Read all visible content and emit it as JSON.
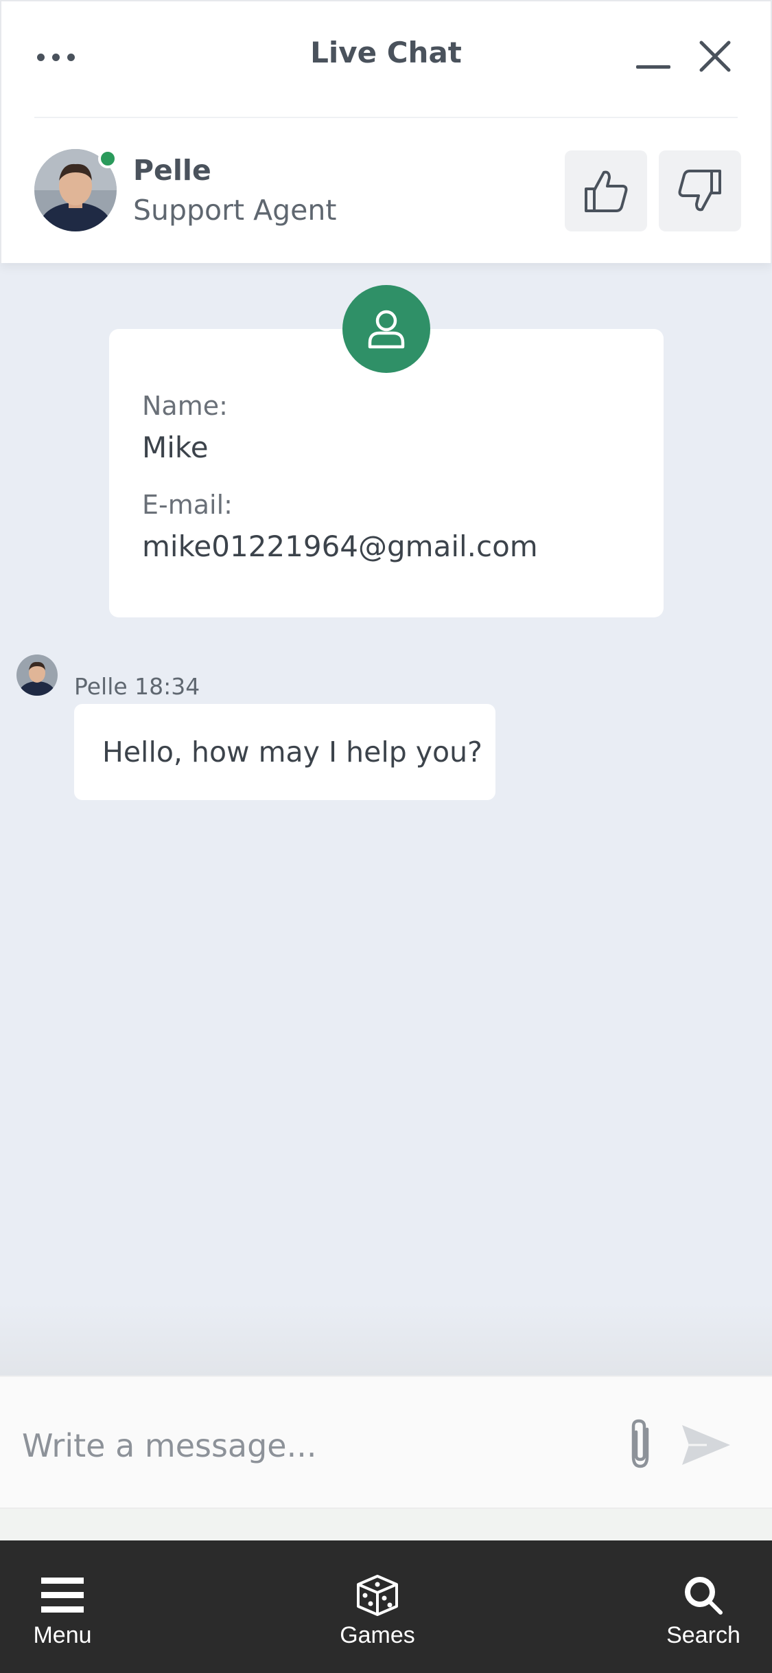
{
  "header": {
    "title": "Live Chat",
    "more_icon": "more-dots-icon",
    "minimize_icon": "minimize-icon",
    "close_icon": "close-icon"
  },
  "agent": {
    "name": "Pelle",
    "role": "Support Agent",
    "status": "online",
    "status_color": "#2a9a5b",
    "rate_up_icon": "thumbs-up-icon",
    "rate_down_icon": "thumbs-down-icon"
  },
  "info_card": {
    "icon": "user-icon",
    "icon_color": "#2f9067",
    "name_label": "Name:",
    "name_value": "Mike",
    "email_label": "E-mail:",
    "email_value": "mike01221964@gmail.com"
  },
  "messages": [
    {
      "meta": "Pelle 18:34",
      "text": "Hello, how may I help you?"
    }
  ],
  "composer": {
    "placeholder": "Write a message...",
    "attach_icon": "paperclip-icon",
    "send_icon": "send-icon"
  },
  "bottom_nav": {
    "items": [
      {
        "label": "Menu",
        "icon": "hamburger-icon"
      },
      {
        "label": "Games",
        "icon": "dice-icon"
      },
      {
        "label": "Search",
        "icon": "search-icon"
      }
    ]
  }
}
